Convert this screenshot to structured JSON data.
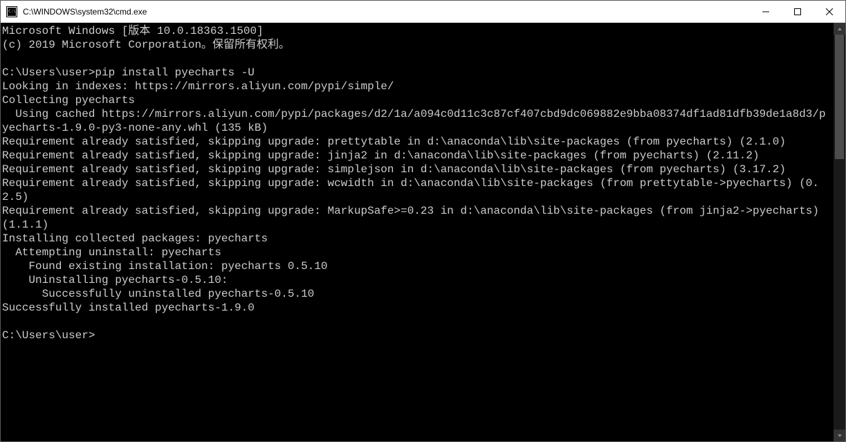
{
  "titlebar": {
    "title": "C:\\WINDOWS\\system32\\cmd.exe"
  },
  "terminal": {
    "lines": [
      "Microsoft Windows [版本 10.0.18363.1500]",
      "(c) 2019 Microsoft Corporation。保留所有权利。",
      "",
      "C:\\Users\\user>pip install pyecharts -U",
      "Looking in indexes: https://mirrors.aliyun.com/pypi/simple/",
      "Collecting pyecharts",
      "  Using cached https://mirrors.aliyun.com/pypi/packages/d2/1a/a094c0d11c3c87cf407cbd9dc069882e9bba08374df1ad81dfb39de1a8d3/pyecharts-1.9.0-py3-none-any.whl (135 kB)",
      "Requirement already satisfied, skipping upgrade: prettytable in d:\\anaconda\\lib\\site-packages (from pyecharts) (2.1.0)",
      "Requirement already satisfied, skipping upgrade: jinja2 in d:\\anaconda\\lib\\site-packages (from pyecharts) (2.11.2)",
      "Requirement already satisfied, skipping upgrade: simplejson in d:\\anaconda\\lib\\site-packages (from pyecharts) (3.17.2)",
      "Requirement already satisfied, skipping upgrade: wcwidth in d:\\anaconda\\lib\\site-packages (from prettytable->pyecharts) (0.2.5)",
      "Requirement already satisfied, skipping upgrade: MarkupSafe>=0.23 in d:\\anaconda\\lib\\site-packages (from jinja2->pyecharts) (1.1.1)",
      "Installing collected packages: pyecharts",
      "  Attempting uninstall: pyecharts",
      "    Found existing installation: pyecharts 0.5.10",
      "    Uninstalling pyecharts-0.5.10:",
      "      Successfully uninstalled pyecharts-0.5.10",
      "Successfully installed pyecharts-1.9.0",
      "",
      "C:\\Users\\user>"
    ]
  }
}
